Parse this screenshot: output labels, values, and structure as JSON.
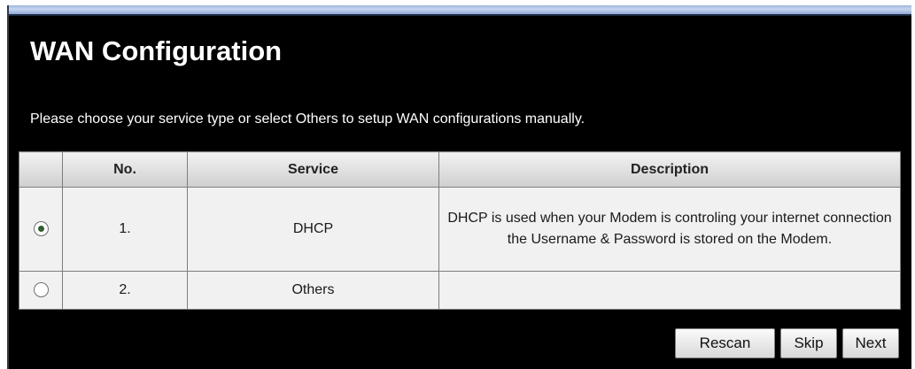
{
  "page": {
    "title": "WAN Configuration",
    "intro": "Please choose your service type or select Others to setup WAN configurations manually."
  },
  "table": {
    "headers": [
      "",
      "No.",
      "Service",
      "Description"
    ],
    "rows": [
      {
        "selected": true,
        "no": "1.",
        "service": "DHCP",
        "description": "DHCP is used when your Modem is controling your internet connection the Username & Password is stored on the Modem."
      },
      {
        "selected": false,
        "no": "2.",
        "service": "Others",
        "description": ""
      }
    ]
  },
  "buttons": {
    "rescan": "Rescan",
    "skip": "Skip",
    "next": "Next"
  },
  "colors": {
    "panel_background": "#000000",
    "title_text": "#ffffff",
    "table_cell": "#f1f1f1",
    "header_gradient_top": "#f2f2f2",
    "header_gradient_bottom": "#cfcfcf",
    "top_bar": "#9fb6dd"
  },
  "icons": {
    "selected_radio": "radio-checked-icon",
    "unselected_radio": "radio-unchecked-icon"
  }
}
